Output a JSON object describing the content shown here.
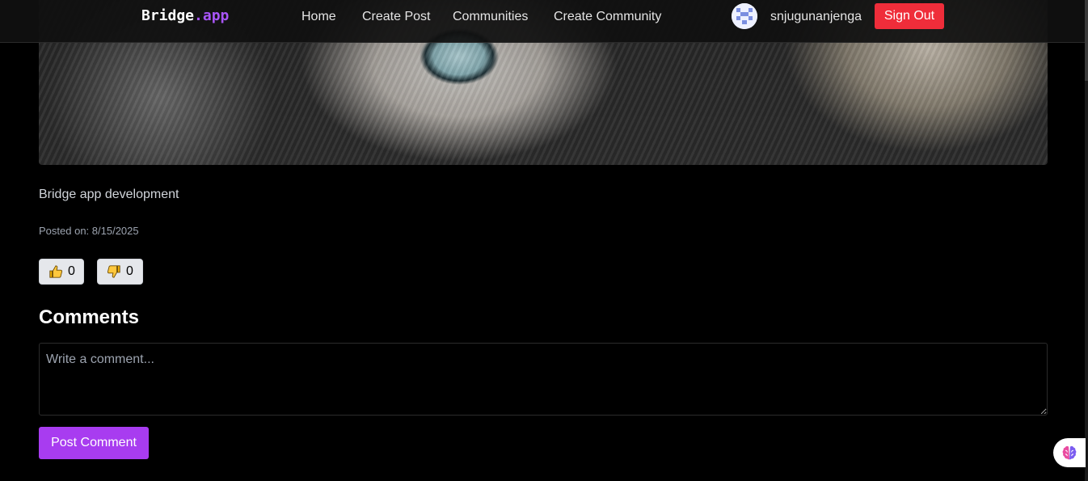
{
  "navbar": {
    "brand_main": "Bridge",
    "brand_accent": ".app",
    "links": [
      "Home",
      "Create Post",
      "Communities",
      "Create Community"
    ],
    "username": "snjugunanjenga",
    "signout_label": "Sign Out"
  },
  "post": {
    "description": "Bridge app development",
    "posted_label": "Posted on:",
    "posted_date": "8/15/2025",
    "likes": "0",
    "dislikes": "0"
  },
  "comments": {
    "heading": "Comments",
    "placeholder": "Write a comment...",
    "submit_label": "Post Comment"
  },
  "icons": {
    "like": "thumbs-up-icon",
    "dislike": "thumbs-down-icon",
    "assistant": "brain-icon"
  },
  "colors": {
    "brand_accent": "#a855f7",
    "signout_bg": "#ef2d3a",
    "primary_button": "#a83cf0",
    "background": "#000000"
  }
}
